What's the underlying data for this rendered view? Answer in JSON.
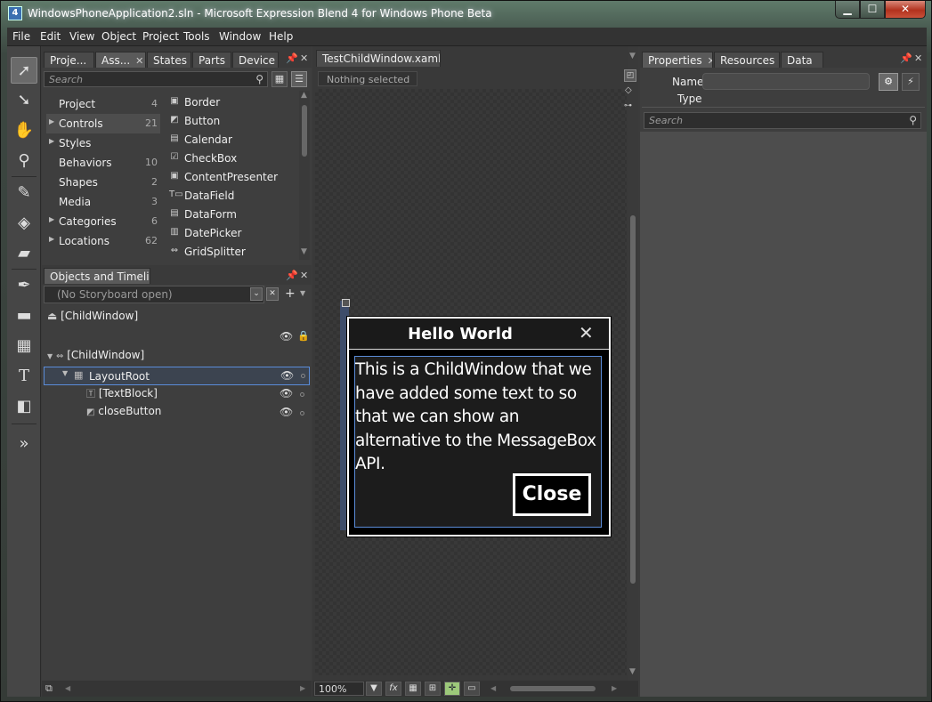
{
  "window": {
    "title": "WindowsPhoneApplication2.sln - Microsoft Expression Blend 4 for Windows Phone Beta",
    "app_icon": "4",
    "min": "▁",
    "max": "☐",
    "close": "✕"
  },
  "menu": [
    "File",
    "Edit",
    "View",
    "Object",
    "Project",
    "Tools",
    "Window",
    "Help"
  ],
  "tools": {
    "selection": "selection-arrow-icon",
    "direct": "direct-select-icon",
    "pan": "hand-icon",
    "zoom": "zoom-icon",
    "eyedropper": "eyedropper-icon",
    "paint": "paint-bucket-icon",
    "brush": "gradient-brush-icon",
    "pen": "pen-icon",
    "rect": "rectangle-icon",
    "grid": "grid-icon",
    "text": "text-icon",
    "button": "button-control-icon",
    "more": "expand-icon"
  },
  "assets_panel": {
    "tabs": [
      "Proje...",
      "Ass...",
      "States",
      "Parts",
      "Device"
    ],
    "search_placeholder": "Search",
    "categories": [
      {
        "label": "Project",
        "count": "4"
      },
      {
        "label": "Controls",
        "count": "21"
      },
      {
        "label": "Styles",
        "count": ""
      },
      {
        "label": "Behaviors",
        "count": "10"
      },
      {
        "label": "Shapes",
        "count": "2"
      },
      {
        "label": "Media",
        "count": "3"
      },
      {
        "label": "Categories",
        "count": "6"
      },
      {
        "label": "Locations",
        "count": "62"
      }
    ],
    "assets": [
      "Border",
      "Button",
      "Calendar",
      "CheckBox",
      "ContentPresenter",
      "DataField",
      "DataForm",
      "DatePicker",
      "GridSplitter"
    ]
  },
  "objects_panel": {
    "title": "Objects and Timeline",
    "storyboard": "(No Storyboard open)",
    "root": "[ChildWindow]",
    "tree": [
      {
        "label": "[ChildWindow]"
      },
      {
        "label": "LayoutRoot"
      },
      {
        "label": "[TextBlock]"
      },
      {
        "label": "closeButton"
      }
    ]
  },
  "document": {
    "tab": "TestChildWindow.xaml",
    "selection": "Nothing selected",
    "zoom": "100%",
    "child_window": {
      "title": "Hello World",
      "text": "This is a ChildWindow that we have added some text to so that we can show an alternative to the MessageBox API.",
      "close_button": "Close"
    }
  },
  "properties_panel": {
    "tabs": [
      "Properties",
      "Resources",
      "Data"
    ],
    "name_label": "Name",
    "type_label": "Type",
    "search_placeholder": "Search"
  }
}
